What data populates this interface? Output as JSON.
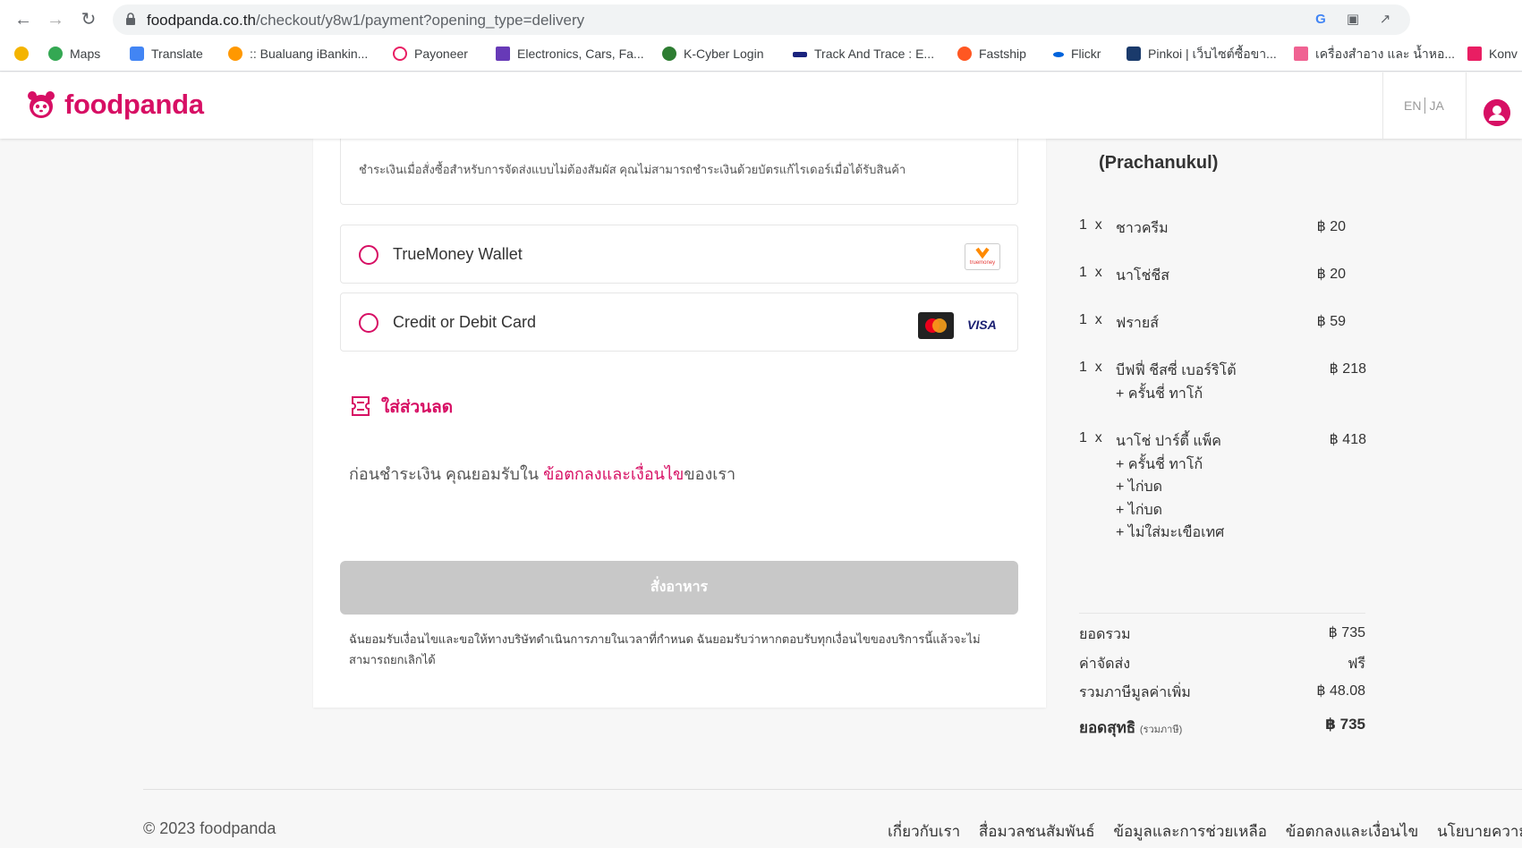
{
  "browser": {
    "url_host": "foodpanda.co.th",
    "url_path": "/checkout/y8w1/payment?opening_type=delivery",
    "bookmarks": [
      {
        "label": "",
        "color": "#f4b400"
      },
      {
        "label": "Maps",
        "color": "#34a853"
      },
      {
        "label": "Translate",
        "color": "#4285f4"
      },
      {
        "label": ":: Bualuang iBankin...",
        "color": "#ff9800"
      },
      {
        "label": "Payoneer",
        "color": "#e91e63"
      },
      {
        "label": "Electronics, Cars, Fa...",
        "color": "#673ab7"
      },
      {
        "label": "K-Cyber Login",
        "color": "#2e7d32"
      },
      {
        "label": "Track And Trace : E...",
        "color": "#1a237e"
      },
      {
        "label": "Fastship",
        "color": "#ff5722"
      },
      {
        "label": "Flickr",
        "color": "#0063dc"
      },
      {
        "label": "Pinkoi | เว็บไซต์ซื้อขา...",
        "color": "#1a3a6b"
      },
      {
        "label": "เครื่องสำอาง และ น้ำหอ...",
        "color": "#f06292"
      },
      {
        "label": "Konv",
        "color": "#e91e63"
      }
    ]
  },
  "header": {
    "logo_text": "foodpanda",
    "lang_en": "EN",
    "lang_ja": "JA",
    "brand_color": "#d70f64"
  },
  "payment": {
    "cash_note": "ชำระเงินเมื่อสั่งซื้อสำหรับการจัดส่งแบบไม่ต้องสัมผัส คุณไม่สามารถชำระเงินด้วยบัตรแก้ไรเดอร์เมื่อได้รับสินค้า",
    "truemoney_label": "TrueMoney Wallet",
    "truemoney_logo_text": "truemoney",
    "card_label": "Credit or Debit Card",
    "visa_text": "VISA",
    "voucher_label": "ใส่ส่วนลด",
    "terms_prefix": "ก่อนชำระเงิน คุณยอมรับใน ",
    "terms_link": "ข้อตกลงและเงื่อนไข",
    "terms_suffix": "ของเรา",
    "order_button": "สั่งอาหาร",
    "disclaimer": "ฉันยอมรับเงื่อนไขและขอให้ทางบริษัทดำเนินการภายในเวลาที่กำหนด ฉันยอมรับว่าหากตอบรับทุกเงื่อนไขของบริการนี้แล้วจะไม่สามารถยกเลิกได้"
  },
  "cart": {
    "restaurant": "(Prachanukul)",
    "items": [
      {
        "qty": "1",
        "x": "x",
        "name": "ชาวครีม",
        "price": "฿ 20",
        "addons": []
      },
      {
        "qty": "1",
        "x": "x",
        "name": "นาโช่ชีส",
        "price": "฿ 20",
        "addons": []
      },
      {
        "qty": "1",
        "x": "x",
        "name": "ฟรายส์",
        "price": "฿ 59",
        "addons": []
      },
      {
        "qty": "1",
        "x": "x",
        "name": "บีฟฟี่ ชีสซี่ เบอร์ริโต้",
        "price": "฿ 218",
        "addons": [
          "+ ครั้นชี่ ทาโก้"
        ]
      },
      {
        "qty": "1",
        "x": "x",
        "name": "นาโช่ ปาร์ตี้ แพ็ค",
        "price": "฿ 418",
        "addons": [
          "+ ครั้นชี่ ทาโก้",
          "+ ไก่บด",
          "+ ไก่บด",
          "+ ไม่ใส่มะเขือเทศ"
        ]
      }
    ],
    "subtotal_label": "ยอดรวม",
    "subtotal_value": "฿ 735",
    "delivery_label": "ค่าจัดส่ง",
    "delivery_value": "ฟรี",
    "vat_label": "รวมภาษีมูลค่าเพิ่ม",
    "vat_value": "฿ 48.08",
    "total_label": "ยอดสุทธิ",
    "total_sub": "(รวมภาษี)",
    "total_value": "฿ 735"
  },
  "footer": {
    "copyright": "© 2023 foodpanda",
    "links": [
      "เกี่ยวกับเรา",
      "สื่อมวลชนสัมพันธ์",
      "ข้อมูลและการช่วยเหลือ",
      "ข้อตกลงและเงื่อนไข",
      "นโยบายความเป็นส"
    ]
  }
}
